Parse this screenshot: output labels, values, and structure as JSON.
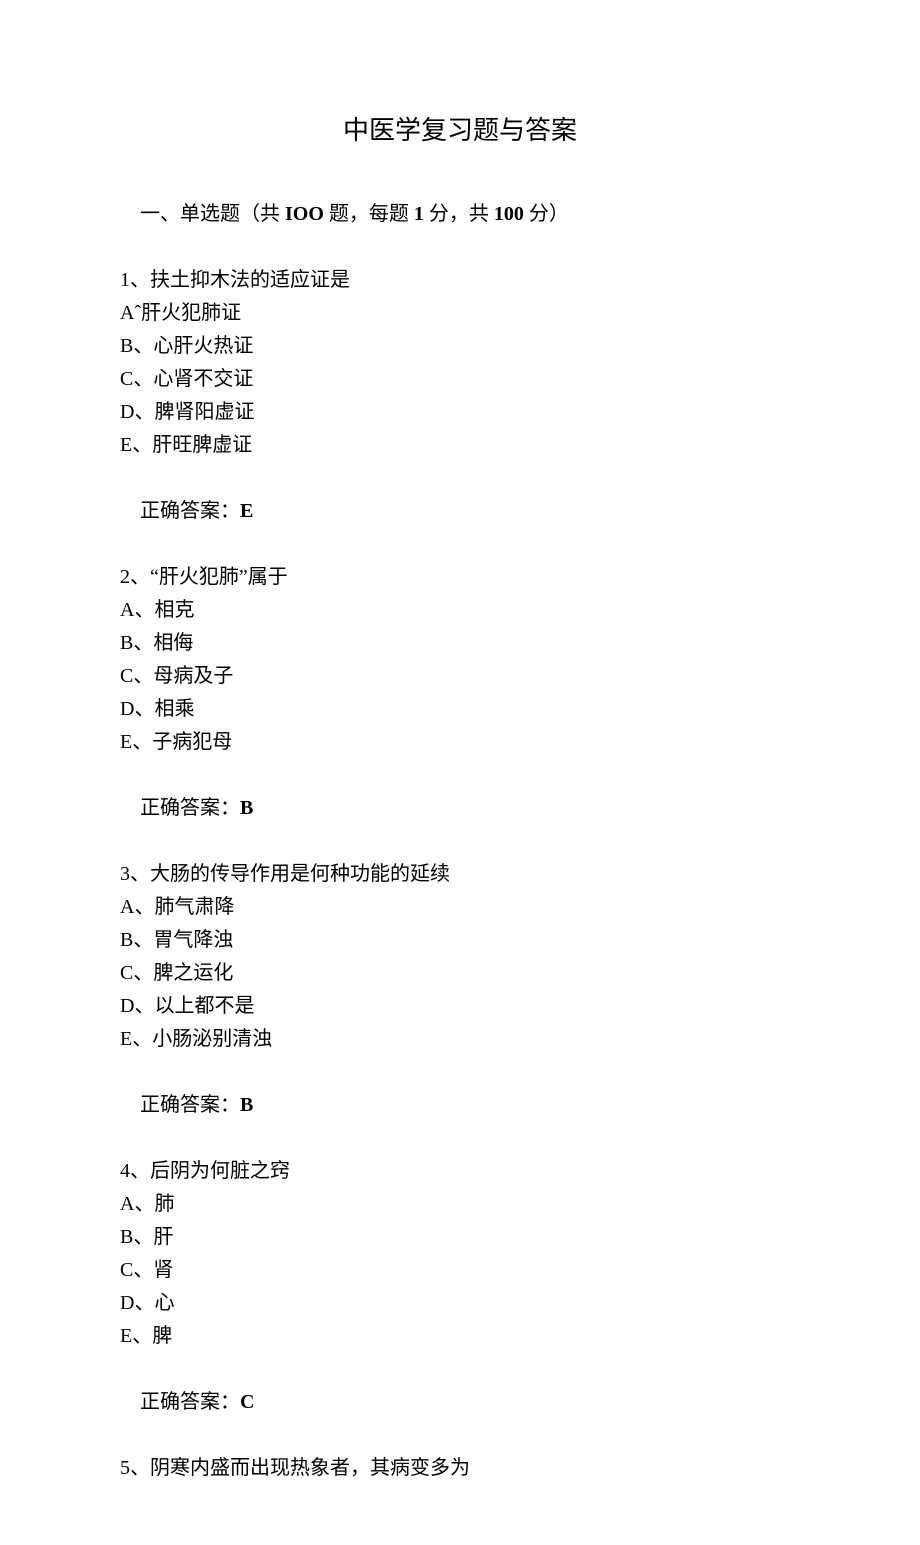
{
  "title": "中医学复习题与答案",
  "section_header": {
    "prefix": "一、单选题（共 ",
    "count_word": "IOO",
    "mid1": " 题，每题 ",
    "per": "1",
    "mid2": " 分，共 ",
    "total": "100",
    "suffix": " 分）"
  },
  "questions": [
    {
      "stem": "1、扶土抑木法的适应证是",
      "options": [
        "Aˆ肝火犯肺证",
        "B、心肝火热证",
        "C、心肾不交证",
        "D、脾肾阳虚证",
        "E、肝旺脾虚证"
      ],
      "answer_label": "正确答案：",
      "answer": "E"
    },
    {
      "stem": "2、“肝火犯肺”属于",
      "options": [
        "A、相克",
        "B、相侮",
        "C、母病及子",
        "D、相乘",
        "E、子病犯母"
      ],
      "answer_label": "正确答案：",
      "answer": "B"
    },
    {
      "stem": "3、大肠的传导作用是何种功能的延续",
      "options": [
        "A、肺气肃降",
        "B、胃气降浊",
        "C、脾之运化",
        "D、以上都不是",
        "E、小肠泌别清浊"
      ],
      "answer_label": "正确答案：",
      "answer": "B"
    },
    {
      "stem": "4、后阴为何脏之窍",
      "options": [
        "A、肺",
        "B、肝",
        "C、肾",
        "D、心",
        "E、脾"
      ],
      "answer_label": "正确答案：",
      "answer": "C"
    },
    {
      "stem": "5、阴寒内盛而出现热象者，其病变多为",
      "options": [],
      "answer_label": "",
      "answer": ""
    }
  ]
}
